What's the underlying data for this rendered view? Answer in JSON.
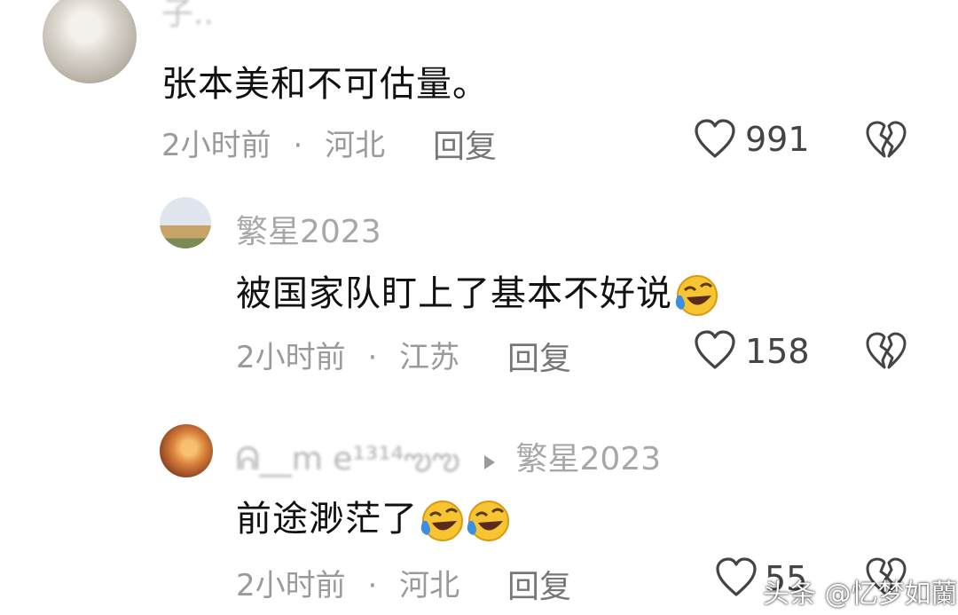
{
  "comments": [
    {
      "username": "子..",
      "text": "张本美和不可估量。",
      "time": "2小时前",
      "location": "河北",
      "reply_label": "回复",
      "likes": "991"
    },
    {
      "username": "繁星2023",
      "text": "被国家队盯上了基本不好说",
      "time": "2小时前",
      "location": "江苏",
      "reply_label": "回复",
      "likes": "158",
      "emoji": "laughing-crying-emoji"
    },
    {
      "username": "ᕱ__m e¹³¹⁴ఌఌ",
      "reply_to": "繁星2023",
      "text": "前途渺茫了",
      "time": "2小时前",
      "location": "河北",
      "reply_label": "回复",
      "likes": "55",
      "emoji": "laughing-crying-emoji"
    }
  ],
  "separator": "·",
  "watermark": "头条 @忆梦如蘭",
  "icons": {
    "like": "heart-icon",
    "dislike": "broken-heart-icon",
    "reply_arrow": "triangle-right-icon"
  },
  "colors": {
    "meta_text": "#9a9a9a",
    "emoji_face": "#f7c531",
    "emoji_tear": "#3b8ee0"
  }
}
